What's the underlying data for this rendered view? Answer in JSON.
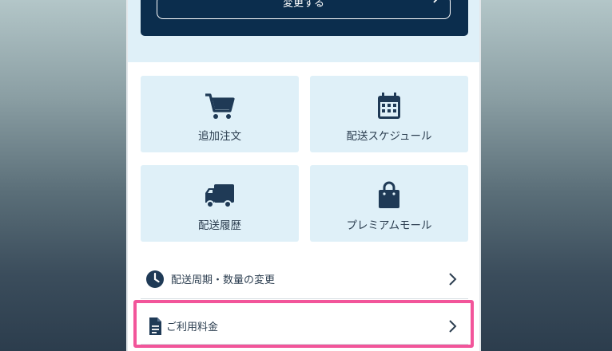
{
  "header": {
    "change_button_label": "変更する"
  },
  "tiles": [
    {
      "label": "追加注文",
      "icon": "cart-icon"
    },
    {
      "label": "配送スケジュール",
      "icon": "calendar-icon"
    },
    {
      "label": "配送履歴",
      "icon": "truck-icon"
    },
    {
      "label": "プレミアムモール",
      "icon": "shopping-bag-icon"
    }
  ],
  "menu_rows": [
    {
      "label": "配送周期・数量の変更",
      "icon": "clock-icon"
    },
    {
      "label": "ご利用料金",
      "icon": "document-icon"
    }
  ],
  "colors": {
    "navy": "#0b2d4d",
    "tile_bg": "#dff0f8",
    "icon": "#1f3a56",
    "highlight": "#f2559a"
  }
}
